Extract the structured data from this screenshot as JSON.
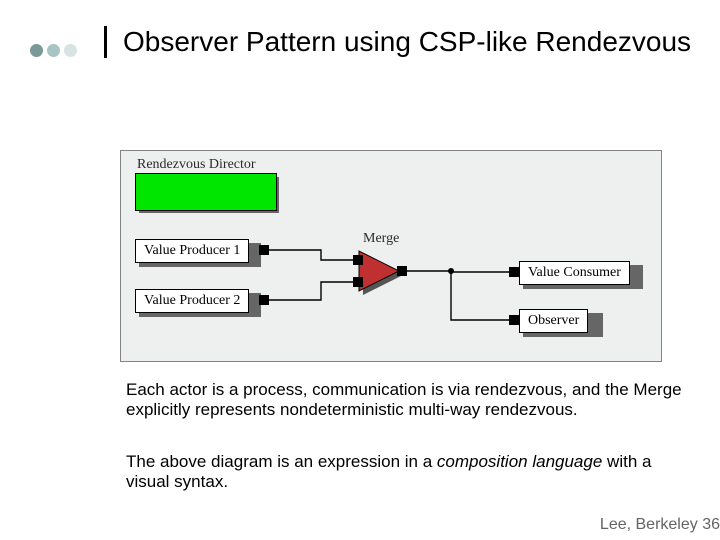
{
  "theme": {
    "bullet_colors": [
      "#7a9a98",
      "#a9c5c3",
      "#d7e4e3"
    ]
  },
  "title": "Observer Pattern using CSP-like Rendezvous",
  "diagram": {
    "director_label": "Rendezvous Director",
    "value_producer_1": "Value Producer 1",
    "value_producer_2": "Value Producer 2",
    "merge_label": "Merge",
    "value_consumer": "Value Consumer",
    "observer": "Observer",
    "merge_fill": "#c03030"
  },
  "paragraph1": "Each actor is a process, communication is via rendezvous, and the Merge explicitly represents nondeterministic multi-way rendezvous.",
  "paragraph2_prefix": "The above diagram is an expression in a ",
  "paragraph2_em": "composition language",
  "paragraph2_suffix": " with a visual syntax.",
  "footer": "Lee, Berkeley 36"
}
